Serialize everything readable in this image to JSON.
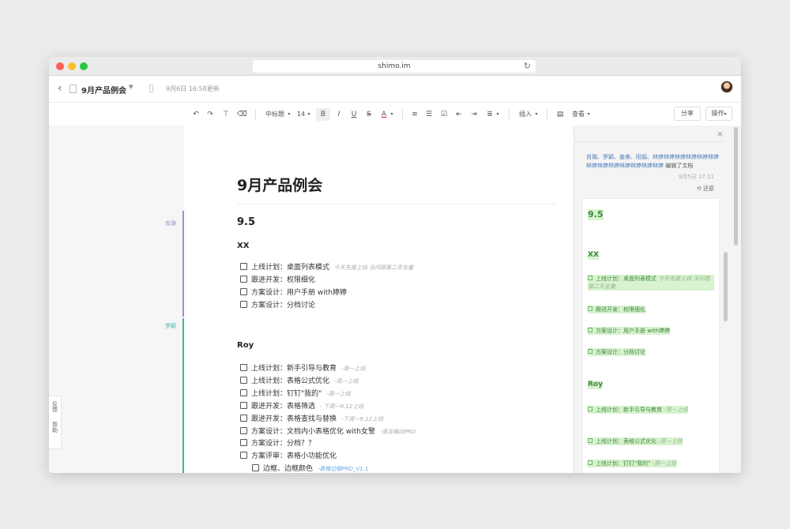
{
  "browser": {
    "url": "shimo.im"
  },
  "header": {
    "doc_title": "9月产品例会",
    "updated": "9月6日 16:58更新"
  },
  "toolbar": {
    "heading_select": "中标题",
    "font_size": "14",
    "bold": "B",
    "italic": "I",
    "underline": "U",
    "strike": "S",
    "font_color": "A",
    "insert": "插入",
    "view": "查看",
    "share": "分享",
    "actions": "操作"
  },
  "authors": [
    {
      "name": "肖璐",
      "color": "#9d8fcf"
    },
    {
      "name": "罗颖",
      "color": "#3cb6a4"
    }
  ],
  "doc": {
    "title": "9月产品例会",
    "section": "9.5",
    "groups": [
      {
        "name": "XX",
        "tasks": [
          {
            "text": "上线计划：桌面列表模式",
            "note": "今天先度上线 没问题第二天全量"
          },
          {
            "text": "跟进开发：权限细化",
            "note": ""
          },
          {
            "text": "方案设计：用户手册 with婷婷",
            "note": ""
          },
          {
            "text": "方案设计：分档讨论",
            "note": ""
          }
        ]
      },
      {
        "name": "Roy",
        "tasks": [
          {
            "text": "上线计划：新手引导与教育",
            "note": "-周一上线"
          },
          {
            "text": "上线计划：表格公式优化",
            "note": "-周一上线"
          },
          {
            "text": "上线计划：钉钉\"我的\"",
            "note": "-周一上线"
          },
          {
            "text": "跟进开发：表格筛选",
            "note": "- 下周一9.12上线"
          },
          {
            "text": "跟进开发：表格查找与替换",
            "note": "-下周一9.12上线"
          },
          {
            "text": "方案设计：文档内小表格优化 with女警",
            "note": "-周五输出PRD"
          },
          {
            "text": "方案设计：分档？？",
            "note": ""
          },
          {
            "text": "方案评审：表格小功能优化",
            "note": ""
          },
          {
            "text": "边框、边框颜色",
            "note": "-表格边框PRD_V1.1",
            "sub": true
          }
        ]
      }
    ]
  },
  "history": {
    "editors": "肖璐、罗颖、姜美、阳娟、林婷林婷林婷林婷林婷林婷林婷林婷林婷林婷林婷林婷林婷",
    "action": "编辑了文档",
    "time": "9月5日 17:11",
    "restore": "还原",
    "section": "9.5",
    "groups": [
      {
        "name": "XX",
        "tasks": [
          {
            "text": "上线计划：桌面列表模式",
            "note": "今天先度上线 没问题第二天全量"
          },
          {
            "text": "跟进开发：权限细化",
            "note": ""
          },
          {
            "text": "方案设计：用户手册 with婷婷",
            "note": ""
          },
          {
            "text": "方案设计：分档讨论",
            "note": ""
          }
        ]
      },
      {
        "name": "Roy",
        "tasks": [
          {
            "text": "上线计划：新手引导与教育",
            "note": "-周一上线"
          },
          {
            "text": "上线计划：表格公式优化",
            "note": "-周一上线"
          },
          {
            "text": "上线计划：钉钉\"我的\"",
            "note": "-周一上线"
          }
        ]
      }
    ]
  },
  "feedback": {
    "label": "反馈",
    "help": "帮助"
  }
}
